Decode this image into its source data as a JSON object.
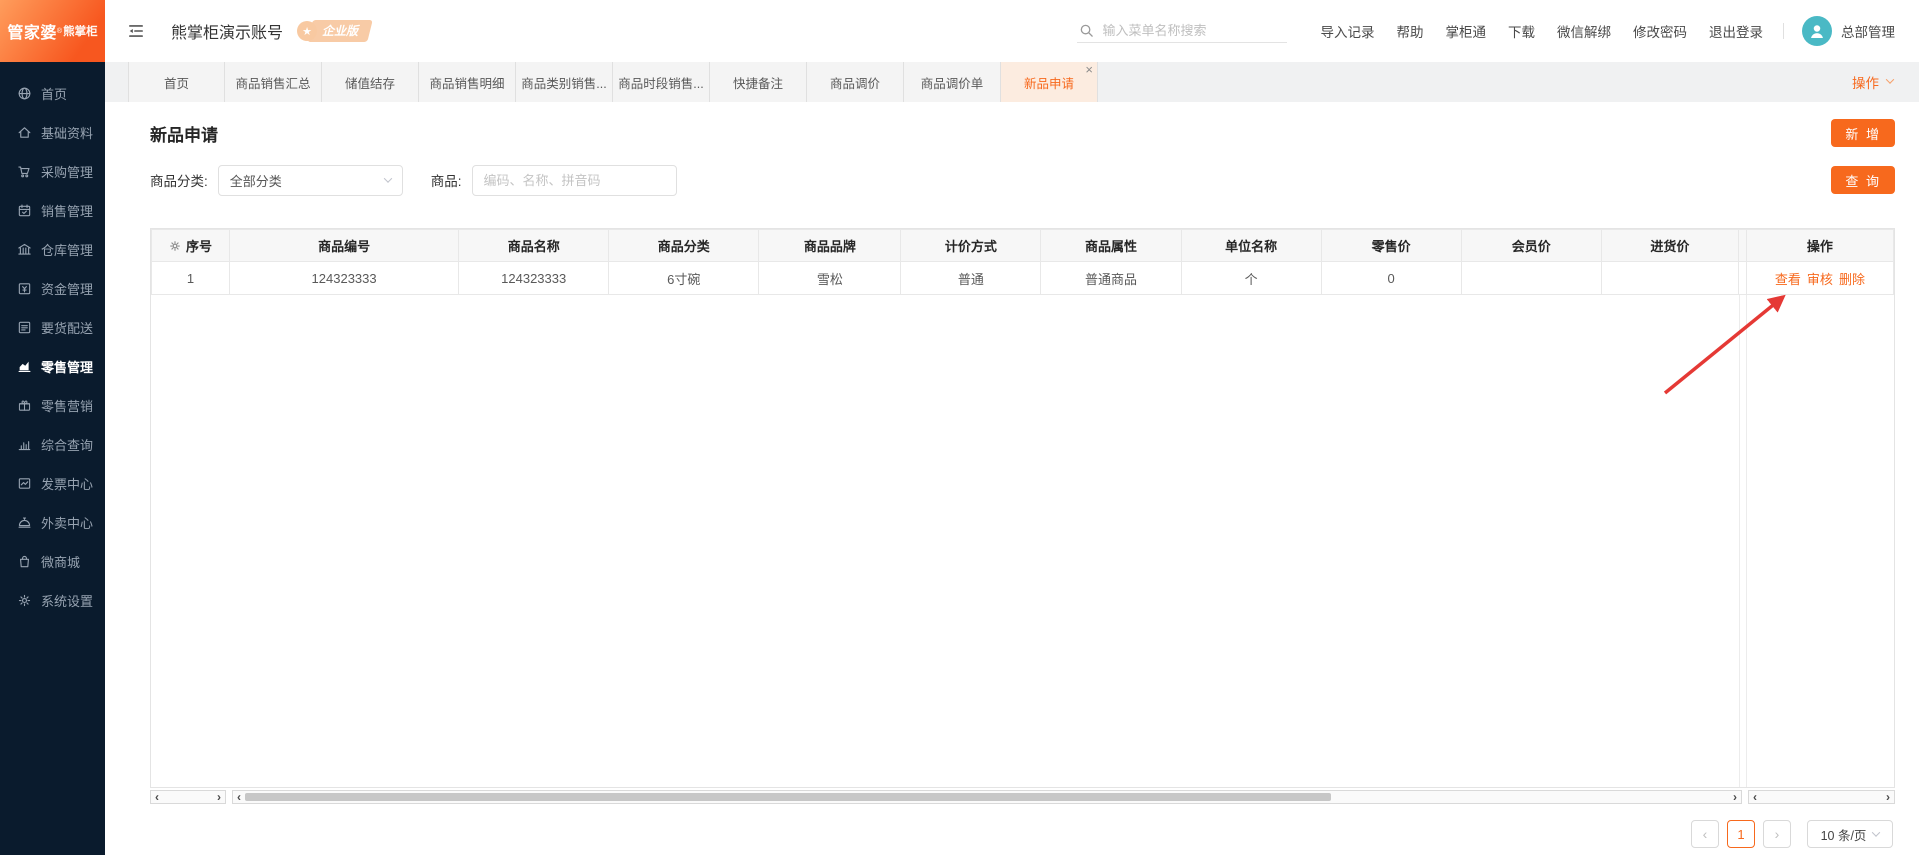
{
  "brand": {
    "main": "管家婆",
    "reg": "®",
    "sub": "熊掌柜"
  },
  "header": {
    "account_title": "熊掌柜演示账号",
    "badge_star": "★",
    "badge": "企业版",
    "search_placeholder": "输入菜单名称搜索",
    "links": [
      "导入记录",
      "帮助",
      "掌柜通",
      "下载",
      "微信解绑",
      "修改密码",
      "退出登录"
    ],
    "user": "总部管理"
  },
  "sidebar": {
    "items": [
      {
        "label": "首页",
        "icon": "globe-icon",
        "active": false
      },
      {
        "label": "基础资料",
        "icon": "home-icon",
        "active": false
      },
      {
        "label": "采购管理",
        "icon": "cart-icon",
        "active": false
      },
      {
        "label": "销售管理",
        "icon": "calendar-check-icon",
        "active": false
      },
      {
        "label": "仓库管理",
        "icon": "warehouse-icon",
        "active": false
      },
      {
        "label": "资金管理",
        "icon": "money-icon",
        "active": false
      },
      {
        "label": "要货配送",
        "icon": "list-box-icon",
        "active": false
      },
      {
        "label": "零售管理",
        "icon": "area-chart-icon",
        "active": true
      },
      {
        "label": "零售营销",
        "icon": "gift-icon",
        "active": false
      },
      {
        "label": "综合查询",
        "icon": "bar-chart-icon",
        "active": false
      },
      {
        "label": "发票中心",
        "icon": "invoice-icon",
        "active": false
      },
      {
        "label": "外卖中心",
        "icon": "cloche-icon",
        "active": false
      },
      {
        "label": "微商城",
        "icon": "bag-icon",
        "active": false
      },
      {
        "label": "系统设置",
        "icon": "gear-icon",
        "active": false
      }
    ]
  },
  "tabs": {
    "close_icon": "×",
    "actions_label": "操作",
    "items": [
      {
        "label": "首页",
        "active": false
      },
      {
        "label": "商品销售汇总",
        "active": false
      },
      {
        "label": "储值结存",
        "active": false
      },
      {
        "label": "商品销售明细",
        "active": false
      },
      {
        "label": "商品类别销售...",
        "active": false
      },
      {
        "label": "商品时段销售...",
        "active": false
      },
      {
        "label": "快捷备注",
        "active": false
      },
      {
        "label": "商品调价",
        "active": false
      },
      {
        "label": "商品调价单",
        "active": false
      },
      {
        "label": "新品申请",
        "active": true
      }
    ]
  },
  "page": {
    "title": "新品申请",
    "add_button": "新 增",
    "query_button": "查 询",
    "filters": {
      "category_label": "商品分类:",
      "category_value": "全部分类",
      "product_label": "商品:",
      "product_placeholder": "编码、名称、拼音码"
    }
  },
  "table": {
    "columns": [
      "序号",
      "商品编号",
      "商品名称",
      "商品分类",
      "商品品牌",
      "计价方式",
      "商品属性",
      "单位名称",
      "零售价",
      "会员价",
      "进货价",
      "操作"
    ],
    "rows": [
      {
        "seq": "1",
        "code": "124323333",
        "name": "124323333",
        "category": "6寸碗",
        "brand": "雪松",
        "pricing": "普通",
        "attr": "普通商品",
        "unit": "个",
        "retail": "0",
        "member": "",
        "purchase": "",
        "actions": [
          "查看",
          "审核",
          "删除"
        ]
      }
    ]
  },
  "scrollbar": {
    "left": "‹",
    "right": "›"
  },
  "pagination": {
    "prev": "‹",
    "current": "1",
    "next": "›",
    "page_size": "10 条/页"
  },
  "colors": {
    "accent_orange": "#f7691d",
    "sidebar_bg": "#0a1b2d",
    "tab_active_bg": "#fcece0",
    "avatar_teal": "#4ab9c5",
    "annotation_arrow_red": "#e53935"
  }
}
